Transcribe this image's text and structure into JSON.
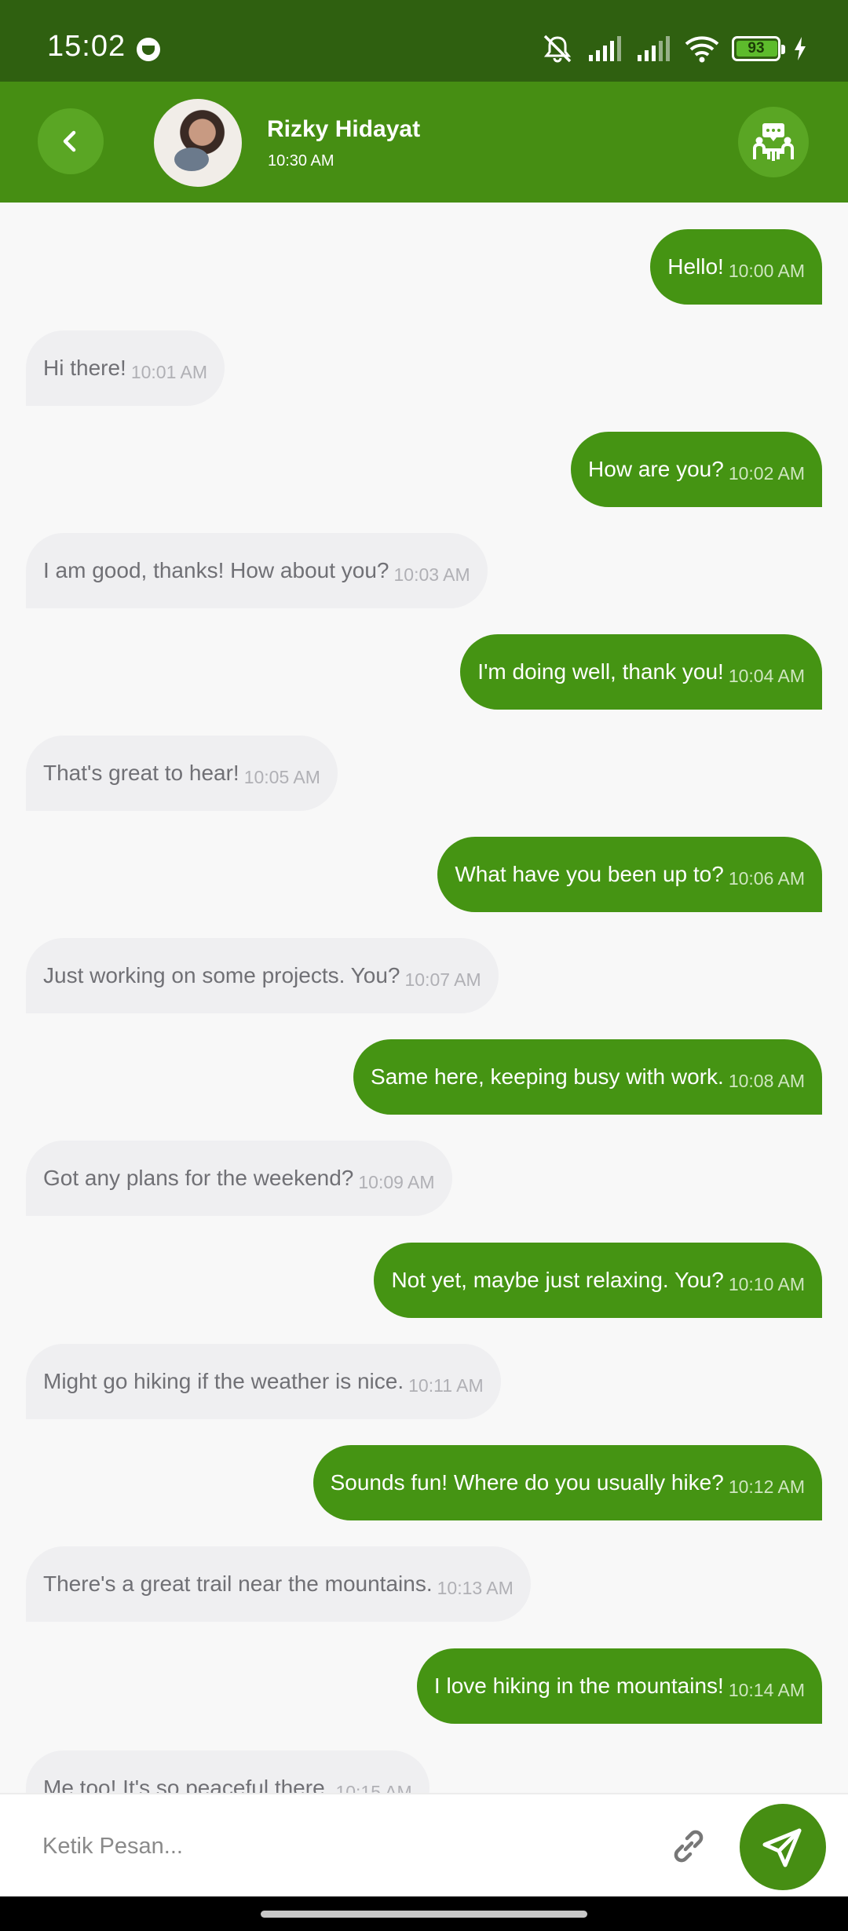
{
  "status_bar": {
    "time": "15:02",
    "battery": "93",
    "icons": [
      "face-icon",
      "mute-icon",
      "signal-icon",
      "signal-icon",
      "wifi-icon",
      "battery-icon",
      "charging-icon"
    ]
  },
  "header": {
    "contact_name": "Rizky Hidayat",
    "last_seen": "10:30 AM",
    "accent_color": "#468e13"
  },
  "messages": [
    {
      "from": "me",
      "text": "Hello!",
      "time": "10:00 AM"
    },
    {
      "from": "them",
      "text": "Hi there!",
      "time": "10:01 AM"
    },
    {
      "from": "me",
      "text": "How are you?",
      "time": "10:02 AM"
    },
    {
      "from": "them",
      "text": "I am good, thanks! How about you?",
      "time": "10:03 AM"
    },
    {
      "from": "me",
      "text": "I'm doing well, thank you!",
      "time": "10:04 AM"
    },
    {
      "from": "them",
      "text": "That's great to hear!",
      "time": "10:05 AM"
    },
    {
      "from": "me",
      "text": "What have you been up to?",
      "time": "10:06 AM"
    },
    {
      "from": "them",
      "text": "Just working on some projects. You?",
      "time": "10:07 AM"
    },
    {
      "from": "me",
      "text": "Same here, keeping busy with work.",
      "time": "10:08 AM"
    },
    {
      "from": "them",
      "text": "Got any plans for the weekend?",
      "time": "10:09 AM"
    },
    {
      "from": "me",
      "text": "Not yet, maybe just relaxing. You?",
      "time": "10:10 AM"
    },
    {
      "from": "them",
      "text": "Might go hiking if the weather is nice.",
      "time": "10:11 AM"
    },
    {
      "from": "me",
      "text": "Sounds fun! Where do you usually hike?",
      "time": "10:12 AM"
    },
    {
      "from": "them",
      "text": "There's a great trail near the mountains.",
      "time": "10:13 AM"
    },
    {
      "from": "me",
      "text": "I love hiking in the mountains!",
      "time": "10:14 AM"
    },
    {
      "from": "them",
      "text": "Me too! It's so peaceful there.",
      "time": "10:15 AM"
    }
  ],
  "composer": {
    "placeholder": "Ketik Pesan..."
  }
}
